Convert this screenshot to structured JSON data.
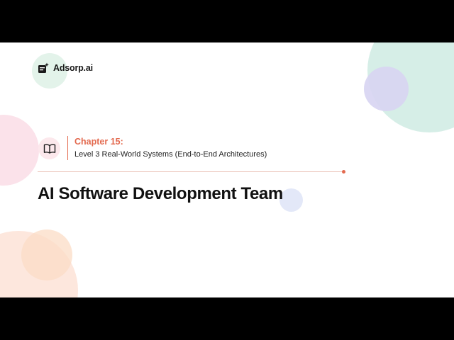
{
  "brand": {
    "name": "Adsorp.ai",
    "logo_icon": "sparkle-document-icon"
  },
  "chapter": {
    "icon": "open-book-icon",
    "label": "Chapter 15:",
    "subtitle": "Level 3 Real-World Systems (End-to-End Architectures)"
  },
  "title": "AI Software Development Team",
  "colors": {
    "accent": "#e36a4f",
    "title_text": "#111111",
    "background": "#ffffff",
    "letterbox": "#000000"
  }
}
